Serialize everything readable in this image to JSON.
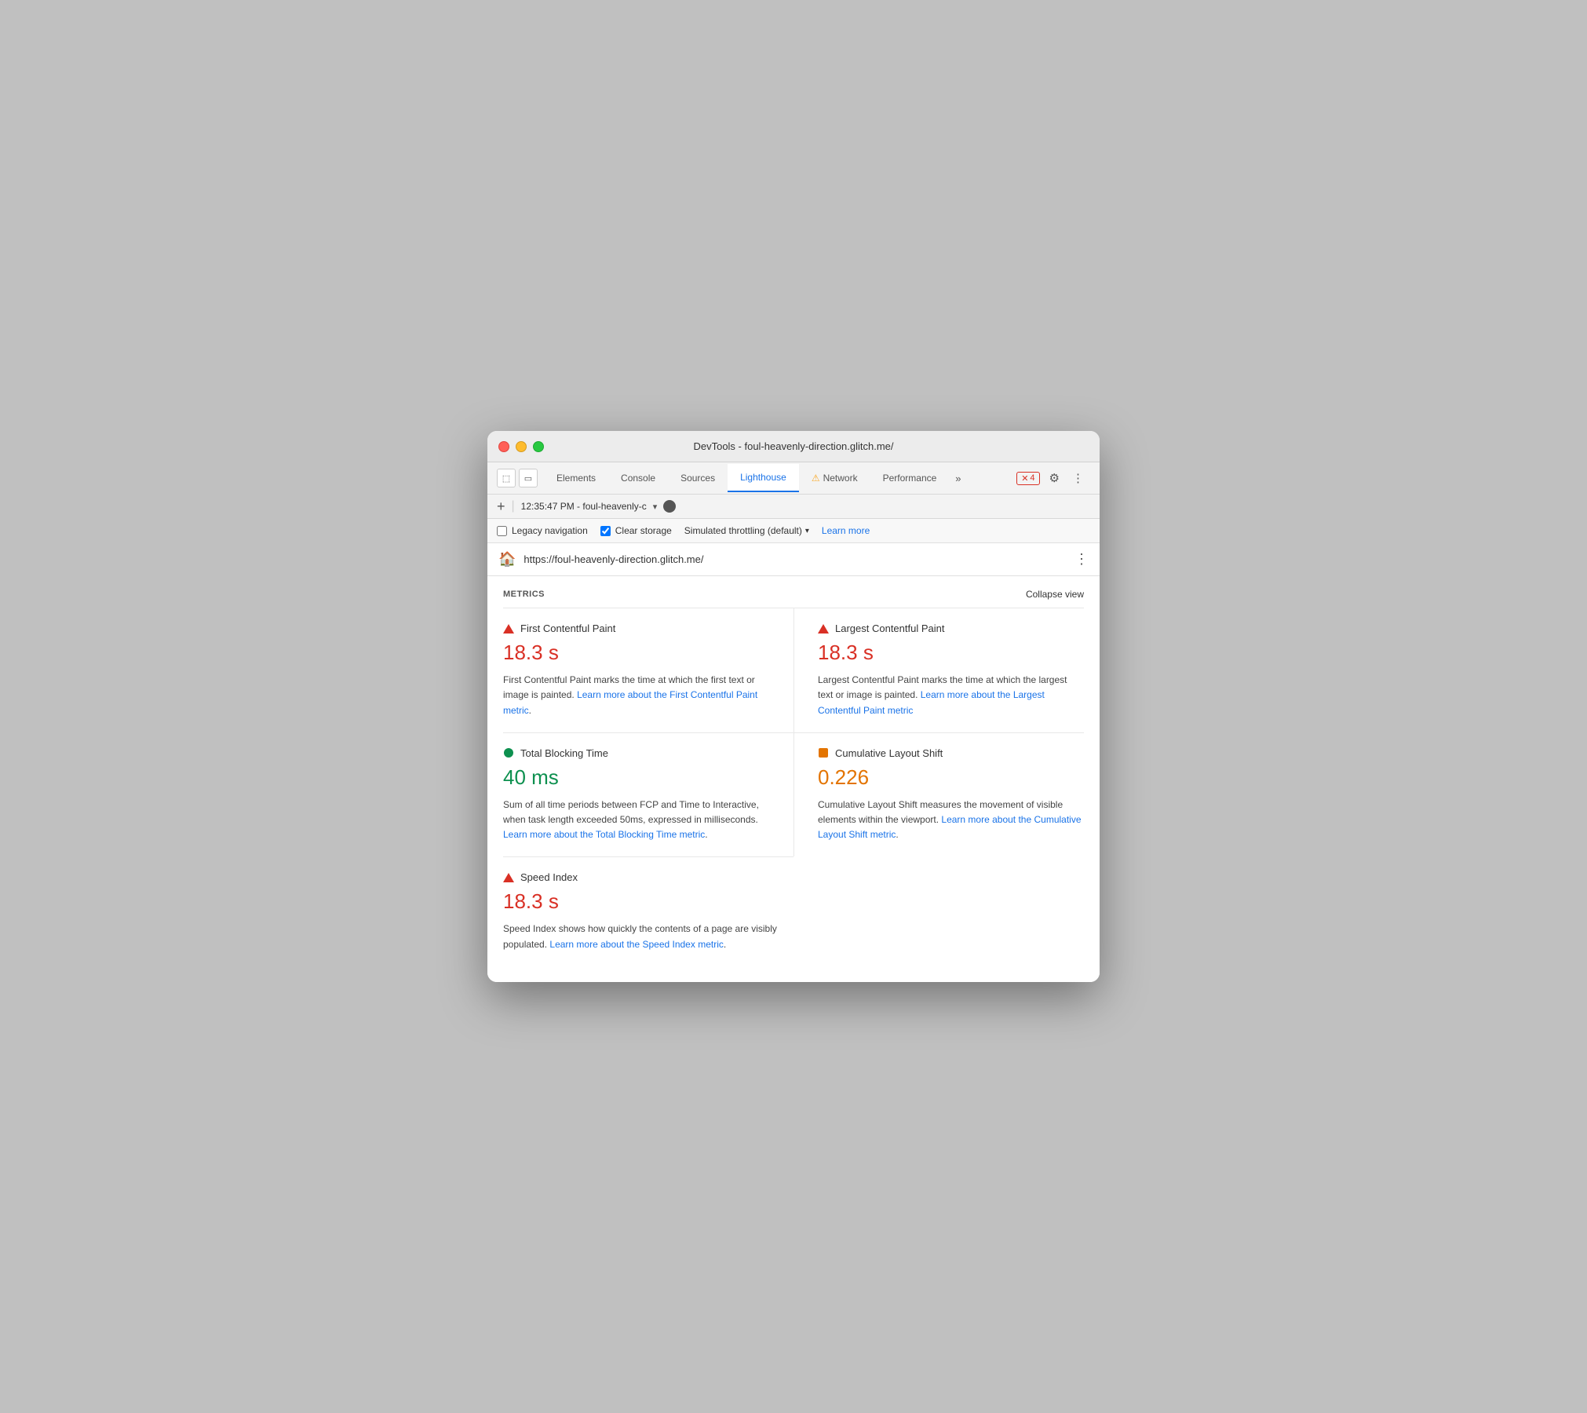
{
  "window": {
    "title": "DevTools - foul-heavenly-direction.glitch.me/"
  },
  "titlebar": {
    "text": "DevTools - foul-heavenly-direction.glitch.me/"
  },
  "tabs": {
    "items": [
      {
        "id": "elements",
        "label": "Elements",
        "active": false,
        "warning": false
      },
      {
        "id": "console",
        "label": "Console",
        "active": false,
        "warning": false
      },
      {
        "id": "sources",
        "label": "Sources",
        "active": false,
        "warning": false
      },
      {
        "id": "lighthouse",
        "label": "Lighthouse",
        "active": true,
        "warning": false
      },
      {
        "id": "network",
        "label": "Network",
        "active": false,
        "warning": true
      },
      {
        "id": "performance",
        "label": "Performance",
        "active": false,
        "warning": false
      }
    ],
    "more_label": "»"
  },
  "tab_actions": {
    "error_count": "4",
    "settings_icon": "⚙",
    "menu_icon": "⋮"
  },
  "secondary_bar": {
    "add_label": "+",
    "session_label": "12:35:47 PM - foul-heavenly-c"
  },
  "options": {
    "legacy_navigation_label": "Legacy navigation",
    "legacy_navigation_checked": false,
    "clear_storage_label": "Clear storage",
    "clear_storage_checked": true,
    "throttling_label": "Simulated throttling (default)",
    "learn_more_label": "Learn more"
  },
  "url_bar": {
    "url": "https://foul-heavenly-direction.glitch.me/",
    "icon": "🏠"
  },
  "metrics": {
    "section_title": "METRICS",
    "collapse_label": "Collapse view",
    "items": [
      {
        "id": "fcp",
        "name": "First Contentful Paint",
        "value": "18.3 s",
        "indicator": "red",
        "desc_before": "First Contentful Paint marks the time at which the first text or image is painted. ",
        "link_text": "Learn more about the First Contentful Paint metric",
        "desc_after": ".",
        "position": "left"
      },
      {
        "id": "lcp",
        "name": "Largest Contentful Paint",
        "value": "18.3 s",
        "indicator": "red",
        "desc_before": "Largest Contentful Paint marks the time at which the largest text or image is painted. ",
        "link_text": "Learn more about the Largest Contentful Paint metric",
        "desc_after": "",
        "position": "right"
      },
      {
        "id": "tbt",
        "name": "Total Blocking Time",
        "value": "40 ms",
        "indicator": "green",
        "desc_before": "Sum of all time periods between FCP and Time to Interactive, when task length exceeded 50ms, expressed in milliseconds. ",
        "link_text": "Learn more about the Total Blocking Time metric",
        "desc_after": ".",
        "position": "left"
      },
      {
        "id": "cls",
        "name": "Cumulative Layout Shift",
        "value": "0.226",
        "indicator": "orange",
        "desc_before": "Cumulative Layout Shift measures the movement of visible elements within the viewport. ",
        "link_text": "Learn more about the Cumulative Layout Shift metric",
        "desc_after": ".",
        "position": "right"
      },
      {
        "id": "si",
        "name": "Speed Index",
        "value": "18.3 s",
        "indicator": "red",
        "desc_before": "Speed Index shows how quickly the contents of a page are visibly populated. ",
        "link_text": "Learn more about the Speed Index metric",
        "desc_after": ".",
        "position": "left"
      }
    ]
  }
}
